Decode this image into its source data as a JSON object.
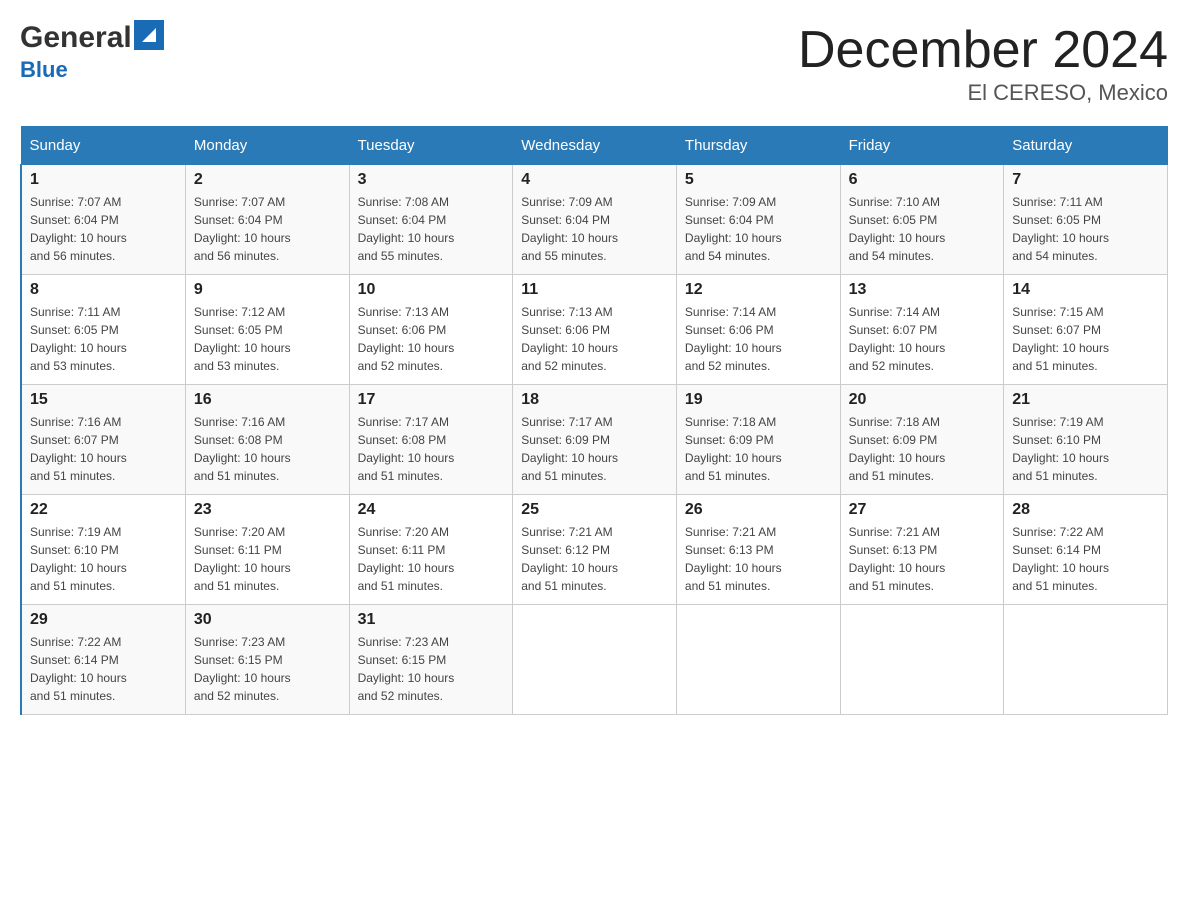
{
  "header": {
    "logo_general": "General",
    "logo_blue": "Blue",
    "month_title": "December 2024",
    "location": "El CERESO, Mexico"
  },
  "days_of_week": [
    "Sunday",
    "Monday",
    "Tuesday",
    "Wednesday",
    "Thursday",
    "Friday",
    "Saturday"
  ],
  "weeks": [
    [
      {
        "day": "1",
        "sunrise": "7:07 AM",
        "sunset": "6:04 PM",
        "daylight": "10 hours and 56 minutes."
      },
      {
        "day": "2",
        "sunrise": "7:07 AM",
        "sunset": "6:04 PM",
        "daylight": "10 hours and 56 minutes."
      },
      {
        "day": "3",
        "sunrise": "7:08 AM",
        "sunset": "6:04 PM",
        "daylight": "10 hours and 55 minutes."
      },
      {
        "day": "4",
        "sunrise": "7:09 AM",
        "sunset": "6:04 PM",
        "daylight": "10 hours and 55 minutes."
      },
      {
        "day": "5",
        "sunrise": "7:09 AM",
        "sunset": "6:04 PM",
        "daylight": "10 hours and 54 minutes."
      },
      {
        "day": "6",
        "sunrise": "7:10 AM",
        "sunset": "6:05 PM",
        "daylight": "10 hours and 54 minutes."
      },
      {
        "day": "7",
        "sunrise": "7:11 AM",
        "sunset": "6:05 PM",
        "daylight": "10 hours and 54 minutes."
      }
    ],
    [
      {
        "day": "8",
        "sunrise": "7:11 AM",
        "sunset": "6:05 PM",
        "daylight": "10 hours and 53 minutes."
      },
      {
        "day": "9",
        "sunrise": "7:12 AM",
        "sunset": "6:05 PM",
        "daylight": "10 hours and 53 minutes."
      },
      {
        "day": "10",
        "sunrise": "7:13 AM",
        "sunset": "6:06 PM",
        "daylight": "10 hours and 52 minutes."
      },
      {
        "day": "11",
        "sunrise": "7:13 AM",
        "sunset": "6:06 PM",
        "daylight": "10 hours and 52 minutes."
      },
      {
        "day": "12",
        "sunrise": "7:14 AM",
        "sunset": "6:06 PM",
        "daylight": "10 hours and 52 minutes."
      },
      {
        "day": "13",
        "sunrise": "7:14 AM",
        "sunset": "6:07 PM",
        "daylight": "10 hours and 52 minutes."
      },
      {
        "day": "14",
        "sunrise": "7:15 AM",
        "sunset": "6:07 PM",
        "daylight": "10 hours and 51 minutes."
      }
    ],
    [
      {
        "day": "15",
        "sunrise": "7:16 AM",
        "sunset": "6:07 PM",
        "daylight": "10 hours and 51 minutes."
      },
      {
        "day": "16",
        "sunrise": "7:16 AM",
        "sunset": "6:08 PM",
        "daylight": "10 hours and 51 minutes."
      },
      {
        "day": "17",
        "sunrise": "7:17 AM",
        "sunset": "6:08 PM",
        "daylight": "10 hours and 51 minutes."
      },
      {
        "day": "18",
        "sunrise": "7:17 AM",
        "sunset": "6:09 PM",
        "daylight": "10 hours and 51 minutes."
      },
      {
        "day": "19",
        "sunrise": "7:18 AM",
        "sunset": "6:09 PM",
        "daylight": "10 hours and 51 minutes."
      },
      {
        "day": "20",
        "sunrise": "7:18 AM",
        "sunset": "6:09 PM",
        "daylight": "10 hours and 51 minutes."
      },
      {
        "day": "21",
        "sunrise": "7:19 AM",
        "sunset": "6:10 PM",
        "daylight": "10 hours and 51 minutes."
      }
    ],
    [
      {
        "day": "22",
        "sunrise": "7:19 AM",
        "sunset": "6:10 PM",
        "daylight": "10 hours and 51 minutes."
      },
      {
        "day": "23",
        "sunrise": "7:20 AM",
        "sunset": "6:11 PM",
        "daylight": "10 hours and 51 minutes."
      },
      {
        "day": "24",
        "sunrise": "7:20 AM",
        "sunset": "6:11 PM",
        "daylight": "10 hours and 51 minutes."
      },
      {
        "day": "25",
        "sunrise": "7:21 AM",
        "sunset": "6:12 PM",
        "daylight": "10 hours and 51 minutes."
      },
      {
        "day": "26",
        "sunrise": "7:21 AM",
        "sunset": "6:13 PM",
        "daylight": "10 hours and 51 minutes."
      },
      {
        "day": "27",
        "sunrise": "7:21 AM",
        "sunset": "6:13 PM",
        "daylight": "10 hours and 51 minutes."
      },
      {
        "day": "28",
        "sunrise": "7:22 AM",
        "sunset": "6:14 PM",
        "daylight": "10 hours and 51 minutes."
      }
    ],
    [
      {
        "day": "29",
        "sunrise": "7:22 AM",
        "sunset": "6:14 PM",
        "daylight": "10 hours and 51 minutes."
      },
      {
        "day": "30",
        "sunrise": "7:23 AM",
        "sunset": "6:15 PM",
        "daylight": "10 hours and 52 minutes."
      },
      {
        "day": "31",
        "sunrise": "7:23 AM",
        "sunset": "6:15 PM",
        "daylight": "10 hours and 52 minutes."
      },
      null,
      null,
      null,
      null
    ]
  ],
  "labels": {
    "sunrise": "Sunrise:",
    "sunset": "Sunset:",
    "daylight": "Daylight:"
  }
}
